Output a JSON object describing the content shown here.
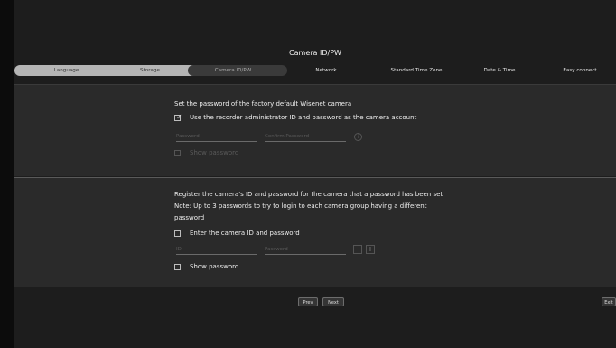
{
  "title": "Camera ID/PW",
  "steps": [
    {
      "label": "Language"
    },
    {
      "label": "Storage"
    },
    {
      "label": "Camera ID/PW"
    },
    {
      "label": "Network"
    },
    {
      "label": "Standard Time Zone"
    },
    {
      "label": "Date & Time"
    },
    {
      "label": "Easy connect"
    }
  ],
  "section1": {
    "heading": "Set the password of the factory default Wisenet camera",
    "use_admin_label": "Use the recorder administrator ID and password as the camera account",
    "use_admin_checked": true,
    "password_placeholder": "Password",
    "confirm_placeholder": "Confirm Password",
    "show_password_label": "Show password"
  },
  "section2": {
    "heading": "Register the camera's ID and password for the camera that a password has been set",
    "note_line1": "Note: Up to 3 passwords to try to login to each camera group having a different",
    "note_line2": "password",
    "enter_label": "Enter the camera ID and password",
    "id_placeholder": "ID",
    "password_placeholder": "Password",
    "minus_symbol": "−",
    "plus_symbol": "+",
    "show_password_label": "Show password"
  },
  "footer": {
    "prev_label": "Prev",
    "next_label": "Next",
    "exit_label": "Exit"
  },
  "colors": {
    "background": "#1d1d1d",
    "section": "#2a2a2a",
    "track": "#b5b5b5"
  }
}
